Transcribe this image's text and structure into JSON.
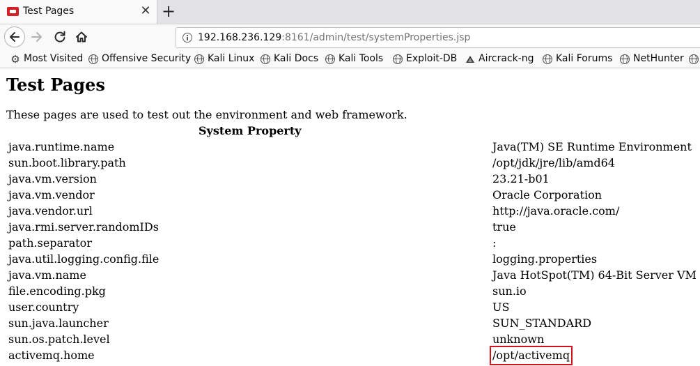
{
  "tab": {
    "title": "Test Pages",
    "close_glyph": "✕",
    "new_tab_glyph": "+"
  },
  "nav": {
    "url_host": "192.168.236.129",
    "url_rest": ":8161/admin/test/systemProperties.jsp"
  },
  "bookmarks": [
    {
      "label": "Most Visited",
      "icon": "gear-icon"
    },
    {
      "label": "Offensive Security",
      "icon": "globe-icon"
    },
    {
      "label": "Kali Linux",
      "icon": "globe-icon"
    },
    {
      "label": "Kali Docs",
      "icon": "globe-icon"
    },
    {
      "label": "Kali Tools",
      "icon": "globe-icon"
    },
    {
      "label": "Exploit-DB",
      "icon": "globe-icon"
    },
    {
      "label": "Aircrack-ng",
      "icon": "aircrack-icon"
    },
    {
      "label": "Kali Forums",
      "icon": "globe-icon"
    },
    {
      "label": "NetHunter",
      "icon": "globe-icon"
    }
  ],
  "page": {
    "title": "Test Pages",
    "description": "These pages are used to test out the environment and web framework.",
    "column_header": "System Property",
    "rows": [
      {
        "key": "java.runtime.name",
        "value": "Java(TM) SE Runtime Environment"
      },
      {
        "key": "sun.boot.library.path",
        "value": "/opt/jdk/jre/lib/amd64"
      },
      {
        "key": "java.vm.version",
        "value": "23.21-b01"
      },
      {
        "key": "java.vm.vendor",
        "value": "Oracle Corporation"
      },
      {
        "key": "java.vendor.url",
        "value": "http://java.oracle.com/"
      },
      {
        "key": "java.rmi.server.randomIDs",
        "value": "true"
      },
      {
        "key": "path.separator",
        "value": ":"
      },
      {
        "key": "java.util.logging.config.file",
        "value": "logging.properties"
      },
      {
        "key": "java.vm.name",
        "value": "Java HotSpot(TM) 64-Bit Server VM"
      },
      {
        "key": "file.encoding.pkg",
        "value": "sun.io"
      },
      {
        "key": "user.country",
        "value": "US"
      },
      {
        "key": "sun.java.launcher",
        "value": "SUN_STANDARD"
      },
      {
        "key": "sun.os.patch.level",
        "value": "unknown"
      },
      {
        "key": "activemq.home",
        "value": "/opt/activemq"
      }
    ],
    "highlight_color": "#d0121c"
  }
}
